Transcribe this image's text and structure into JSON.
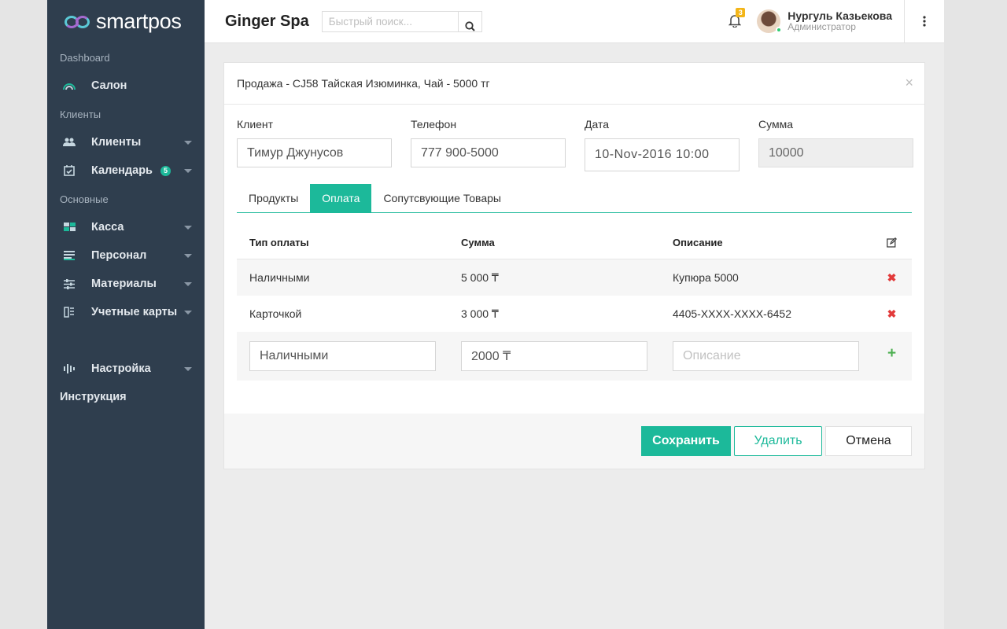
{
  "app": {
    "logo_text": "smartpos",
    "brand": "Ginger Spa"
  },
  "search": {
    "placeholder": "Быстрый поиск..."
  },
  "notifications": {
    "count": "3"
  },
  "user": {
    "name": "Нургуль Казьекова",
    "role": "Администратор"
  },
  "sidebar": {
    "sections": {
      "dashboard": "Dashboard",
      "clients": "Клиенты",
      "main": "Основные"
    },
    "items": {
      "salon": "Салон",
      "clients": "Клиенты",
      "calendar": "Календарь",
      "calendar_badge": "5",
      "cash": "Касса",
      "staff": "Персонал",
      "materials": "Материалы",
      "accounts": "Учетные карты",
      "settings": "Настройка",
      "instructions": "Инструкция"
    },
    "icons": [
      "rainbow-icon",
      "users-icon",
      "calendar-check-icon",
      "cash-icon",
      "staff-icon",
      "sliders-icon",
      "cards-icon",
      "settings-icon"
    ]
  },
  "modal": {
    "title": "Продажа - CJ58 Тайская Изюминка, Чай - 5000 тг",
    "fields": {
      "client_label": "Клиент",
      "client_value": "Тимур Джунусов",
      "phone_label": "Телефон",
      "phone_value": "777 900-5000",
      "date_label": "Дата",
      "date_value": "10-Nov-2016 10:00",
      "sum_label": "Сумма",
      "sum_value": "10000"
    },
    "tabs": [
      "Продукты",
      "Оплата",
      "Сопутсвующие Товары"
    ],
    "active_tab": "Оплата",
    "table": {
      "headers": {
        "type": "Тип оплаты",
        "sum": "Сумма",
        "desc": "Описание"
      },
      "rows": [
        {
          "type": "Наличными",
          "sum": "5 000 ₸",
          "desc": "Купюра 5000"
        },
        {
          "type": "Карточкой",
          "sum": "3 000 ₸",
          "desc": "4405-XXXX-XXXX-6452"
        }
      ],
      "new_row": {
        "type": "Наличными",
        "sum": "2000 ₸",
        "desc_placeholder": "Описание"
      }
    },
    "buttons": {
      "save": "Сохранить",
      "delete": "Удалить",
      "cancel": "Отмена"
    }
  },
  "colors": {
    "accent": "#1cb99a",
    "sidebar": "#2f3e4e",
    "danger": "#e23a3a",
    "add": "#4caf50",
    "badge": "#f3b518"
  }
}
